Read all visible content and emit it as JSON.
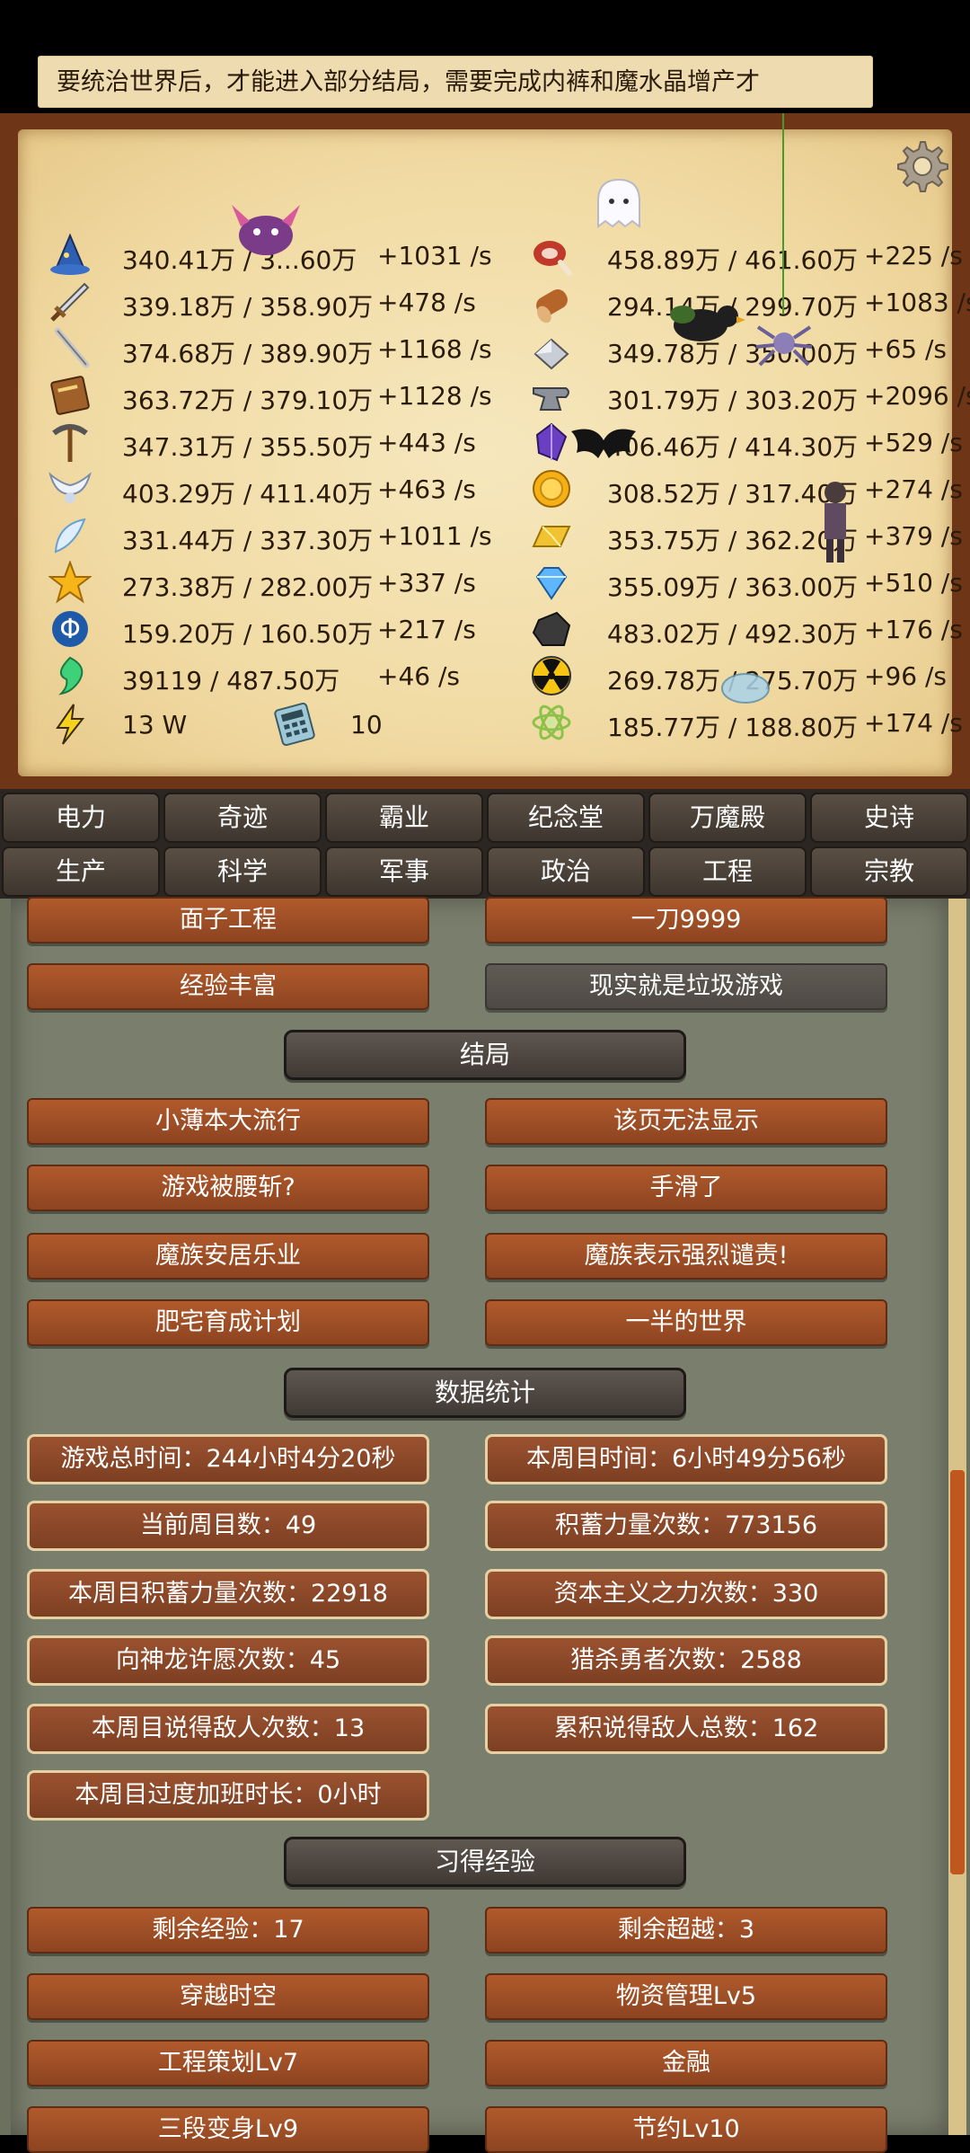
{
  "notice": "要统治世界后，才能进入部分结局，需要完成内裤和魔水晶增产才",
  "icons": {
    "settings": "gear-icon",
    "left_column": [
      "wizard-hat-icon",
      "sword-icon",
      "wand-icon",
      "book-icon",
      "pickaxe-icon",
      "wings-icon",
      "feather-icon",
      "star-icon",
      "phi-icon",
      "spirit-icon",
      "lightning-icon"
    ],
    "right_column": [
      "meat-icon",
      "wood-icon",
      "iron-icon",
      "anvil-icon",
      "crystal-icon",
      "gold-coin-icon",
      "gold-bar-icon",
      "diamond-icon",
      "coal-icon",
      "radiation-icon",
      "atom-icon"
    ]
  },
  "resources_left": [
    {
      "value": "340.41万 / 3...60万",
      "rate": "+1031 /s"
    },
    {
      "value": "339.18万 / 358.90万",
      "rate": "+478 /s"
    },
    {
      "value": "374.68万 / 389.90万",
      "rate": "+1168 /s"
    },
    {
      "value": "363.72万 / 379.10万",
      "rate": "+1128 /s"
    },
    {
      "value": "347.31万 / 355.50万",
      "rate": "+443 /s"
    },
    {
      "value": "403.29万 / 411.40万",
      "rate": "+463 /s"
    },
    {
      "value": "331.44万 / 337.30万",
      "rate": "+1011 /s"
    },
    {
      "value": "273.38万 / 282.00万",
      "rate": "+337 /s"
    },
    {
      "value": "159.20万 / 160.50万",
      "rate": "+217 /s"
    },
    {
      "value": "39119 / 487.50万",
      "rate": "+46 /s"
    }
  ],
  "power": {
    "value": "13 W",
    "calculator_value": "10"
  },
  "resources_right": [
    {
      "value": "458.89万 / 461.60万",
      "rate": "+225 /s"
    },
    {
      "value": "294.14万 / 299.70万",
      "rate": "+1083 /s"
    },
    {
      "value": "349.78万 / 350.00万",
      "rate": "+65 /s"
    },
    {
      "value": "301.79万 / 303.20万",
      "rate": "+2096 /s"
    },
    {
      "value": "406.46万 / 414.30万",
      "rate": "+529 /s"
    },
    {
      "value": "308.52万 / 317.40万",
      "rate": "+274 /s"
    },
    {
      "value": "353.75万 / 362.20万",
      "rate": "+379 /s"
    },
    {
      "value": "355.09万 / 363.00万",
      "rate": "+510 /s"
    },
    {
      "value": "483.02万 / 492.30万",
      "rate": "+176 /s"
    },
    {
      "value": "269.78万 / 275.70万",
      "rate": "+96 /s"
    },
    {
      "value": "185.77万 / 188.80万",
      "rate": "+174 /s"
    }
  ],
  "tabs_row1": [
    "电力",
    "奇迹",
    "霸业",
    "纪念堂",
    "万魔殿",
    "史诗"
  ],
  "tabs_row2": [
    "生产",
    "科学",
    "军事",
    "政治",
    "工程",
    "宗教"
  ],
  "top_buttons": [
    {
      "left": "面子工程",
      "right": "一刀9999"
    },
    {
      "left": "经验丰富",
      "right": "现实就是垃圾游戏"
    }
  ],
  "section_endings": "结局",
  "endings": [
    {
      "left": "小薄本大流行",
      "right": "该页无法显示"
    },
    {
      "left": "游戏被腰斩?",
      "right": "手滑了"
    },
    {
      "left": "魔族安居乐业",
      "right": "魔族表示强烈谴责!"
    },
    {
      "left": "肥宅育成计划",
      "right": "一半的世界"
    }
  ],
  "section_stats": "数据统计",
  "stats": [
    {
      "left": "游戏总时间：244小时4分20秒",
      "right": "本周目时间：6小时49分56秒"
    },
    {
      "left": "当前周目数：49",
      "right": "积蓄力量次数：773156"
    },
    {
      "left": "本周目积蓄力量次数：22918",
      "right": "资本主义之力次数：330"
    },
    {
      "left": "向神龙许愿次数：45",
      "right": "猎杀勇者次数：2588"
    },
    {
      "left": "本周目说得敌人次数：13",
      "right": "累积说得敌人总数：162"
    },
    {
      "left": "本周目过度加班时长：0小时",
      "right": ""
    }
  ],
  "section_experience": "习得经验",
  "experience": [
    {
      "left": "剩余经验：17",
      "right": "剩余超越：3"
    },
    {
      "left": "穿越时空",
      "right": "物资管理Lv5"
    },
    {
      "left": "工程策划Lv7",
      "right": "金融"
    },
    {
      "left": "三段变身Lv9",
      "right": "节约Lv10"
    }
  ],
  "colors": {
    "parchment": "#f1dba4",
    "frame": "#6e3516",
    "wood_button": "#a0522d",
    "dark_button": "#5a544e",
    "stone_bg": "#7a7e6c",
    "scroll_thumb": "#c0571f"
  }
}
